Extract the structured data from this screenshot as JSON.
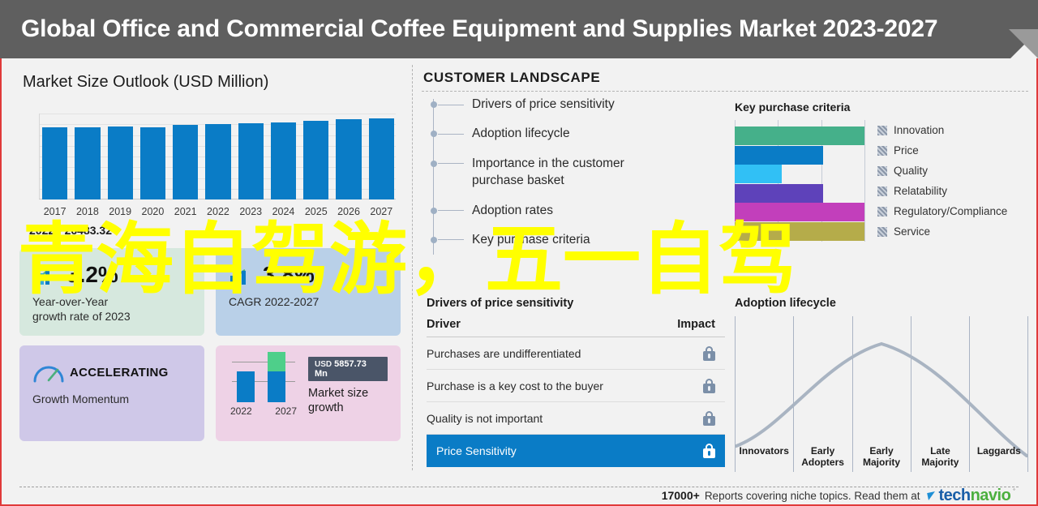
{
  "header": {
    "title": "Global Office and Commercial Coffee Equipment and Supplies Market 2023-2027"
  },
  "left_panel": {
    "title": "Market Size Outlook (USD Million)",
    "caption": "2022 - 26483.32",
    "cards": [
      {
        "id": "yoy-growth",
        "value": "3.2%",
        "label_line1": "Year-over-Year",
        "label_line2": "growth rate of 2023",
        "color": "#d6e8de",
        "icon": "bar-growth-icon"
      },
      {
        "id": "cagr",
        "value": "3.8%",
        "label_line1": "CAGR 2022-2027",
        "label_line2": "",
        "color": "#b9d0e8",
        "icon": "bar-growth-icon"
      },
      {
        "id": "growth-momentum",
        "value": "ACCELERATING",
        "label_line1": "Growth Momentum",
        "label_line2": "",
        "color": "#cfc8e8",
        "icon": "speedometer-icon"
      },
      {
        "id": "market-size-growth",
        "badge_unit": "USD",
        "badge_value": "5857.73 Mn",
        "label_line1": "Market size",
        "label_line2": "growth",
        "color": "#eed2e6",
        "icon": "growth-bars-icon",
        "year_start": "2022",
        "year_end": "2027"
      }
    ]
  },
  "customer_landscape": {
    "title": "CUSTOMER LANDSCAPE",
    "items": [
      "Drivers of price sensitivity",
      "Adoption lifecycle",
      "Importance in the customer purchase basket",
      "Adoption rates",
      "Key purchase criteria"
    ]
  },
  "driver_table": {
    "title": "Drivers of price sensitivity",
    "columns": [
      "Driver",
      "Impact"
    ],
    "rows": [
      {
        "driver": "Purchases are undifferentiated",
        "impact_icon": "lock-icon",
        "highlighted": false
      },
      {
        "driver": "Purchase is a key cost to the buyer",
        "impact_icon": "lock-icon",
        "highlighted": false
      },
      {
        "driver": "Quality is not important",
        "impact_icon": "lock-icon",
        "highlighted": false
      },
      {
        "driver": "Price Sensitivity",
        "impact_icon": "lock-icon",
        "highlighted": true
      }
    ]
  },
  "key_purchase_criteria": {
    "title": "Key purchase criteria",
    "legend": [
      "Innovation",
      "Price",
      "Quality",
      "Relatability",
      "Regulatory/Compliance",
      "Service"
    ]
  },
  "adoption_lifecycle": {
    "title": "Adoption lifecycle",
    "stages": [
      "Innovators",
      "Early Adopters",
      "Early Majority",
      "Late Majority",
      "Laggards"
    ]
  },
  "footer": {
    "count": "17000+",
    "text": "Reports covering niche topics. Read them at",
    "brand_part1": "tech",
    "brand_part2": "navio",
    "trademark": "˚"
  },
  "watermark": {
    "text": "青海自驾游，五一自驾",
    "color": "#ffff00"
  },
  "chart_data": [
    {
      "type": "bar",
      "id": "market-size-outlook",
      "title": "Market Size Outlook (USD Million)",
      "xlabel": "",
      "ylabel": "USD Million",
      "categories": [
        "2017",
        "2018",
        "2019",
        "2020",
        "2021",
        "2022",
        "2023",
        "2024",
        "2025",
        "2026",
        "2027"
      ],
      "values": [
        24300,
        24450,
        24600,
        24400,
        25100,
        25350,
        25700,
        26000,
        26600,
        27000,
        27350
      ],
      "ylim": [
        0,
        29000
      ],
      "grid": true,
      "legend": "none",
      "bar_color": "#0a7cc6",
      "annotation": "2022 - 26483.32"
    },
    {
      "type": "bar",
      "id": "key-purchase-criteria",
      "title": "Key purchase criteria",
      "orientation": "horizontal",
      "categories": [
        "Innovation",
        "Price",
        "Quality",
        "Relatability",
        "Regulatory/Compliance",
        "Service"
      ],
      "values": [
        100,
        68,
        36,
        68,
        100,
        100
      ],
      "xlim": [
        0,
        100
      ],
      "grid": true,
      "legend": "right",
      "colors": [
        "#45b08a",
        "#0a7cc6",
        "#31c0f5",
        "#5e42ba",
        "#c23fbb",
        "#b5ac4a"
      ]
    },
    {
      "type": "line",
      "id": "adoption-lifecycle",
      "title": "Adoption lifecycle",
      "x": [
        "Innovators",
        "Early Adopters",
        "Early Majority",
        "Late Majority",
        "Laggards"
      ],
      "xlabel": "",
      "ylabel": "Adoption",
      "values": [
        5,
        62,
        100,
        55,
        3
      ],
      "grid": false,
      "legend": "none",
      "line_color": "#a9b4c2",
      "note": "bell curve peaking at Early Majority"
    },
    {
      "type": "bar",
      "id": "market-size-growth-mini",
      "title": "Market size growth",
      "categories": [
        "2022",
        "2027"
      ],
      "values": [
        55,
        100
      ],
      "colors": [
        "#0a7cc6",
        "#4ecf8a"
      ],
      "grid": true,
      "legend": "none",
      "annotation": "USD 5857.73 Mn"
    }
  ]
}
